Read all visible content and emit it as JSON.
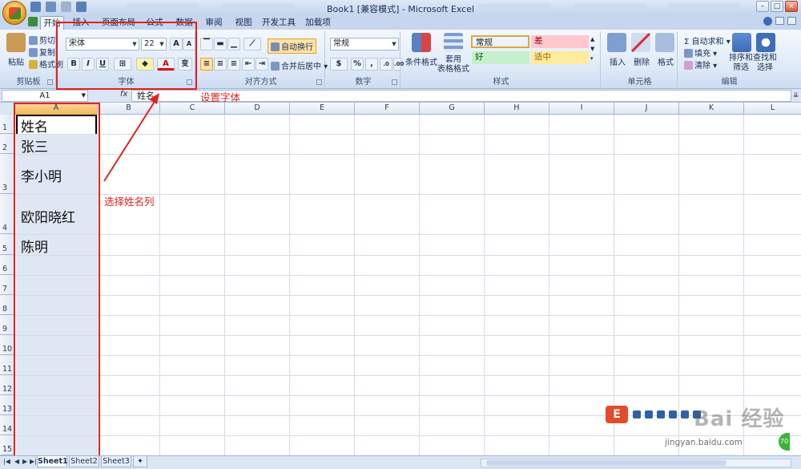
{
  "app": {
    "title": "Book1  [兼容模式] - Microsoft Excel",
    "window_controls": [
      "–",
      "□",
      "×"
    ]
  },
  "ribbon_tabs": [
    "开始",
    "插入",
    "页面布局",
    "公式",
    "数据",
    "审阅",
    "视图",
    "开发工具",
    "加载项"
  ],
  "clipboard": {
    "paste": "粘贴",
    "cut": "剪切",
    "copy": "复制",
    "format_painter": "格式刷",
    "group": "剪贴板"
  },
  "font": {
    "name": "宋体",
    "size": "22",
    "grow": "A",
    "shrink": "A",
    "bold": "B",
    "italic": "I",
    "underline": "U",
    "font_color": "A",
    "wen": "变",
    "group": "字体"
  },
  "alignment": {
    "wrap": "自动换行",
    "merge": "合并后居中",
    "group": "对齐方式"
  },
  "number": {
    "format": "常规",
    "percent": "%",
    "comma": ",",
    "group": "数字"
  },
  "styles": {
    "conditional": "条件格式",
    "table": "套用\n表格格式",
    "cells": [
      {
        "label": "常规",
        "bg": "#ffffff",
        "fg": "#000000"
      },
      {
        "label": "差",
        "bg": "#ffc7ce",
        "fg": "#9c0006"
      },
      {
        "label": "好",
        "bg": "#c6efce",
        "fg": "#006100"
      },
      {
        "label": "适中",
        "bg": "#ffeb9c",
        "fg": "#9c6500"
      }
    ],
    "group": "样式"
  },
  "cells_group": {
    "insert": "插入",
    "delete": "删除",
    "format": "格式",
    "group": "单元格"
  },
  "editing": {
    "autosum": "自动求和",
    "fill": "填充",
    "clear": "清除",
    "sort": "排序和\n筛选",
    "find": "查找和\n选择",
    "group": "编辑"
  },
  "formula_bar": {
    "name_box": "A1",
    "fx": "fx",
    "content": "姓名"
  },
  "columns": [
    "A",
    "B",
    "C",
    "D",
    "E",
    "F",
    "G",
    "H",
    "I",
    "J",
    "K",
    "L"
  ],
  "rows": [
    "1",
    "2",
    "3",
    "4",
    "5",
    "6",
    "7",
    "8",
    "9",
    "10",
    "11",
    "12",
    "13",
    "14",
    "15"
  ],
  "cells": [
    "姓名",
    "张三",
    "李小明",
    "欧阳晓红",
    "陈明"
  ],
  "annotations": {
    "set_font": "设置字体",
    "select_column": "选择姓名列",
    "color": "#e3221b"
  },
  "sheets": [
    "Sheet1",
    "Sheet2",
    "Sheet3"
  ],
  "watermark": {
    "brand": "Bai 经验",
    "url": "jingyan.baidu.com",
    "badge": "70"
  }
}
